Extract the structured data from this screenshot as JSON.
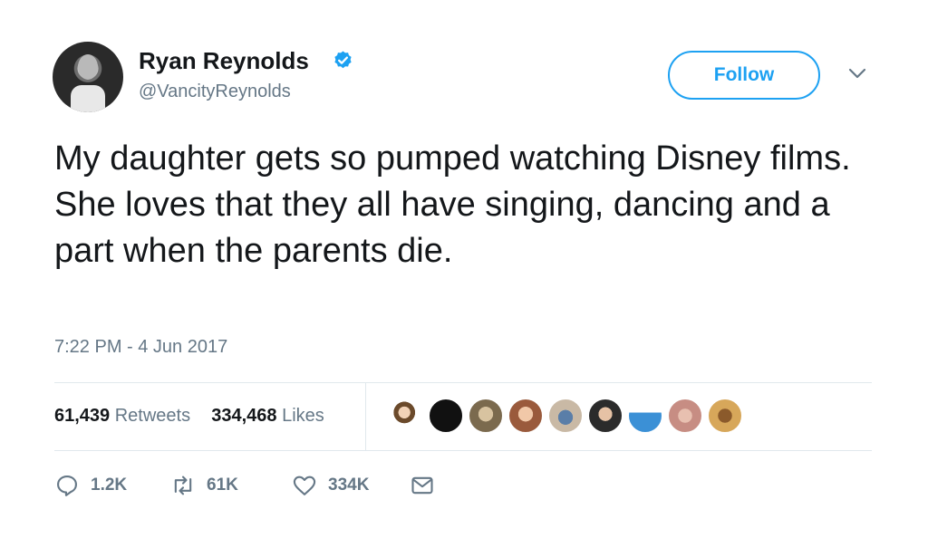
{
  "user": {
    "name": "Ryan Reynolds",
    "handle": "@VancityReynolds",
    "verified": true
  },
  "header": {
    "follow_label": "Follow",
    "menu_icon": "chevron-down-icon"
  },
  "tweet": {
    "text": "My daughter gets so pumped watching Disney films. She loves that they all have singing, dancing and a part when the parents die.",
    "timestamp": "7:22 PM - 4 Jun 2017"
  },
  "stats": {
    "retweets_count": "61,439",
    "retweets_label": "Retweets",
    "likes_count": "334,468",
    "likes_label": "Likes"
  },
  "actions": {
    "reply_count": "1.2K",
    "retweet_count": "61K",
    "like_count": "334K"
  },
  "colors": {
    "accent": "#1da1f2",
    "secondary_text": "#657786",
    "divider": "#e1e8ed"
  }
}
